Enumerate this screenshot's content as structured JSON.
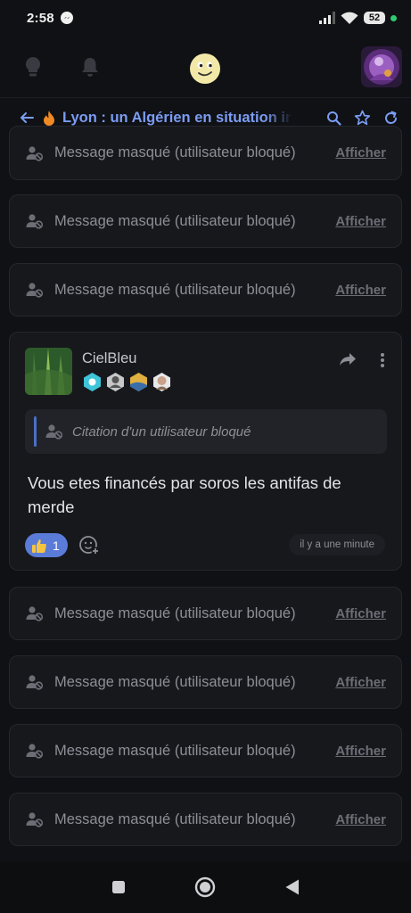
{
  "status_bar": {
    "time": "2:58",
    "battery": "52"
  },
  "topic": {
    "title": "Lyon : un Algérien en situation irrégulière"
  },
  "masked_label": "Message masqué (utilisateur bloqué)",
  "show_label": "Afficher",
  "masked_messages_above": [
    {
      "label": "Message masqué (utilisateur bloqué)",
      "action": "Afficher"
    },
    {
      "label": "Message masqué (utilisateur bloqué)",
      "action": "Afficher"
    },
    {
      "label": "Message masqué (utilisateur bloqué)",
      "action": "Afficher"
    }
  ],
  "post": {
    "username": "CielBleu",
    "quote": "Citation d'un utilisateur bloqué",
    "body": "Vous etes financés par soros les antifas de merde",
    "likes": "1",
    "time": "il y a une minute"
  },
  "masked_messages_below": [
    {
      "label": "Message masqué (utilisateur bloqué)",
      "action": "Afficher"
    },
    {
      "label": "Message masqué (utilisateur bloqué)",
      "action": "Afficher"
    },
    {
      "label": "Message masqué (utilisateur bloqué)",
      "action": "Afficher"
    },
    {
      "label": "Message masqué (utilisateur bloqué)",
      "action": "Afficher"
    }
  ],
  "colors": {
    "accent": "#7b9cf4",
    "like": "#5a7bd8",
    "background": "#101114",
    "card": "#17181c"
  },
  "icons": [
    "messenger-icon",
    "signal-icon",
    "wifi-icon",
    "battery-icon",
    "lightbulb-icon",
    "bell-icon",
    "smiley-logo-icon",
    "back-arrow-icon",
    "fire-icon",
    "search-icon",
    "star-icon",
    "refresh-icon",
    "blocked-user-icon",
    "share-icon",
    "more-vertical-icon",
    "thumbs-up-icon",
    "add-reaction-icon",
    "nav-square-icon",
    "nav-home-icon",
    "nav-back-icon"
  ]
}
